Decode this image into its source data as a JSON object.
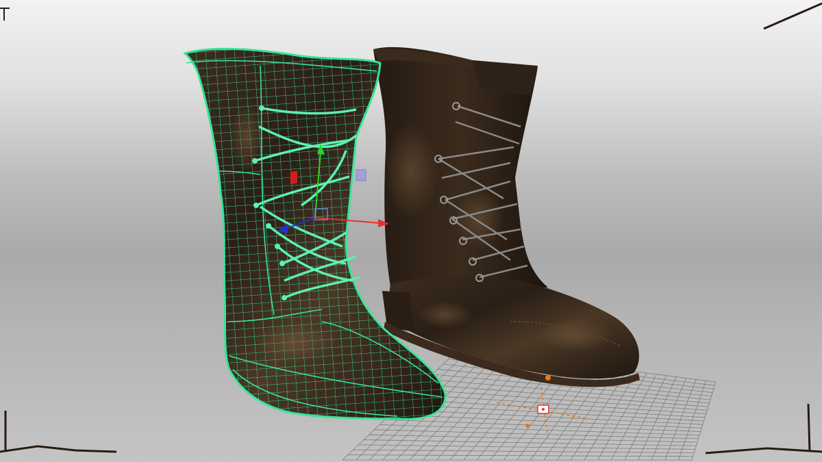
{
  "viewport": {
    "background_top": "#f2f2f2",
    "background_mid": "#a9a9a9",
    "background_bottom": "#c4c4c4"
  },
  "colors": {
    "wireframe": "#37e49a",
    "leather_dark": "#2b2018",
    "leather_mid": "#4a3726",
    "leather_highlight": "#6a5038",
    "sole": "#3a2a1e",
    "lace": "#7a7a7a",
    "grid": "#6d6d6d",
    "gizmo_x": "#e53030",
    "gizmo_y": "#2bd42b",
    "gizmo_z": "#1d2fe8",
    "gizmo_plane": "#7b7bd8",
    "pivot": "#e9780c",
    "frame": "#2a1a12"
  },
  "objects": {
    "wireframe_boot": "wireframe-boot",
    "textured_boot": "textured-boot",
    "ground_grid": "ground-grid",
    "transform_gizmo": "move-gizmo"
  }
}
